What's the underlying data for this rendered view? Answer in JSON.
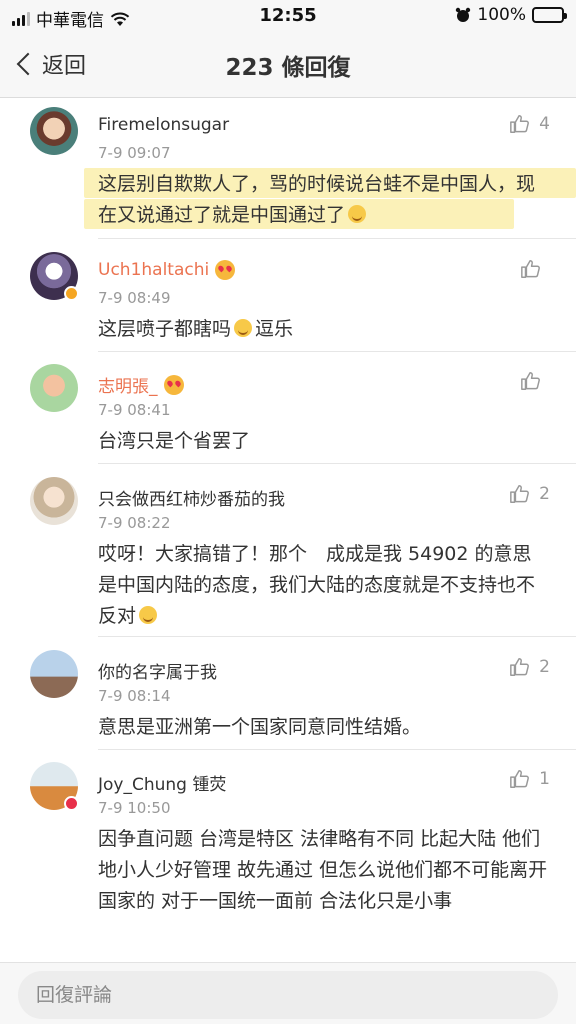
{
  "status_bar": {
    "carrier": "中華電信",
    "time": "12:55",
    "battery": "100%"
  },
  "nav": {
    "back_label": "返回",
    "title": "223 條回復"
  },
  "colors": {
    "vip_name": "#eb7350",
    "highlight": "#fbf1b8",
    "timestamp": "#999999"
  },
  "comments": [
    {
      "username": "Firemelonsugar",
      "time": "7-9 09:07",
      "likes": "4",
      "text": "这层别自欺欺人了，骂的时候说台蛙不是中国人，现在又说通过了就是中国通过了"
    },
    {
      "username": "Uch1haltachi",
      "time": "7-9 08:49",
      "likes": "",
      "text_pre": "这层喷子都瞎吗",
      "text_post": "逗乐"
    },
    {
      "username": "志明張_",
      "time": "7-9 08:41",
      "likes": "",
      "text": "台湾只是个省罢了"
    },
    {
      "username": "只会做西红柿炒番茄的我",
      "time": "7-9 08:22",
      "likes": "2",
      "text": "哎呀！大家搞错了！那个　成成是我 54902 的意思是中国内陆的态度，我们大陆的态度就是不支持也不反对"
    },
    {
      "username": "你的名字属于我",
      "time": "7-9 08:14",
      "likes": "2",
      "text": "意思是亚洲第一个国家同意同性结婚。"
    },
    {
      "username": "Joy_Chung 锺荧",
      "time": "7-9 10:50",
      "likes": "1",
      "text": "因争直问题 台湾是特区 法律略有不同 比起大陆 他们地小人少好管理 故先通过 但怎么说他们都不可能离开国家的 对于一国统一面前 合法化只是小事"
    }
  ],
  "reply": {
    "placeholder": "回復評論"
  }
}
